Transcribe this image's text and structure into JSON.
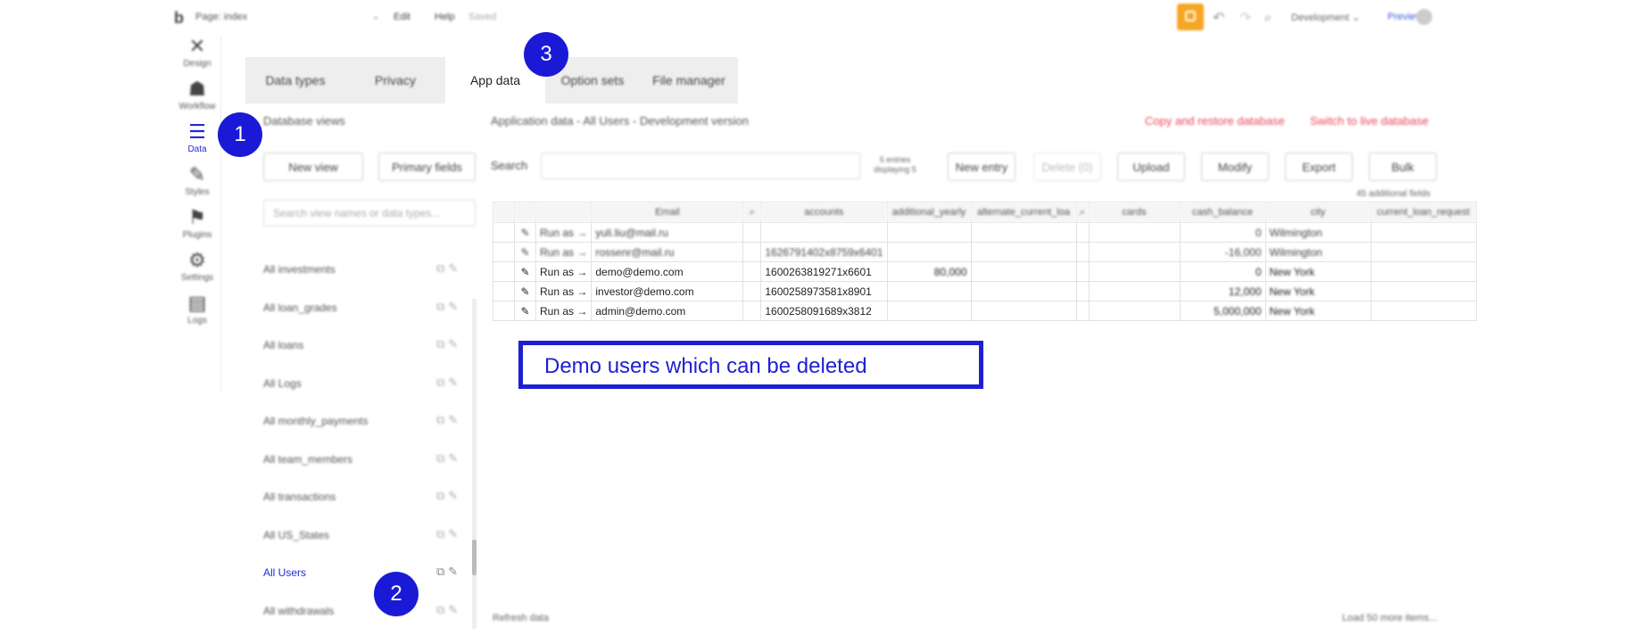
{
  "topbar": {
    "logo": "b",
    "page_title": "Page: index",
    "page_chevron": "⌄",
    "menu_edit": "Edit",
    "menu_help": "Help",
    "saved": "Saved",
    "undo_glyph": "↶",
    "redo_glyph": "↷",
    "search_glyph": "⌕",
    "environment": "Development ⌄",
    "preview": "Preview"
  },
  "rail": [
    {
      "label": "Design",
      "glyph": "✕",
      "active": false
    },
    {
      "label": "Workflow",
      "glyph": "☗",
      "active": false
    },
    {
      "label": "Data",
      "glyph": "☰",
      "active": true
    },
    {
      "label": "Styles",
      "glyph": "✎",
      "active": false
    },
    {
      "label": "Plugins",
      "glyph": "⚑",
      "active": false
    },
    {
      "label": "Settings",
      "glyph": "⚙",
      "active": false
    },
    {
      "label": "Logs",
      "glyph": "▤",
      "active": false
    }
  ],
  "tabs": [
    {
      "label": "Data types",
      "active": false
    },
    {
      "label": "Privacy",
      "active": false
    },
    {
      "label": "App data",
      "active": true
    },
    {
      "label": "Option sets",
      "active": false
    },
    {
      "label": "File manager",
      "active": false
    }
  ],
  "db_panel": {
    "title": "Database views",
    "new_view": "New view",
    "primary_fields": "Primary fields",
    "search_placeholder": "Search view names or data types...",
    "views": [
      {
        "label": "All investments",
        "active": false
      },
      {
        "label": "All loan_grades",
        "active": false
      },
      {
        "label": "All loans",
        "active": false
      },
      {
        "label": "All Logs",
        "active": false
      },
      {
        "label": "All monthly_payments",
        "active": false
      },
      {
        "label": "All team_members",
        "active": false
      },
      {
        "label": "All transactions",
        "active": false
      },
      {
        "label": "All US_States",
        "active": false
      },
      {
        "label": "All Users",
        "active": true
      },
      {
        "label": "All withdrawals",
        "active": false
      }
    ]
  },
  "app_data": {
    "title": "Application data - All Users - Development version",
    "copy_restore": "Copy and restore database",
    "switch_live": "Switch to live database",
    "search_label": "Search",
    "entries_info": "5 entries displaying 5",
    "new_entry": "New entry",
    "delete": "Delete (0)",
    "upload": "Upload",
    "modify": "Modify",
    "export": "Export",
    "bulk": "Bulk",
    "additional_fields": "45 additional fields",
    "refresh": "Refresh data",
    "load_more": "Load 50 more items..."
  },
  "table": {
    "columns": [
      "",
      "",
      "",
      "Email",
      "⌕",
      "accounts",
      "additional_yearly",
      "alternate_current_loa",
      "⌕",
      "cards",
      "cash_balance",
      "city",
      "current_loan_request"
    ],
    "rows": [
      {
        "blur": true,
        "run_as": "Run as →",
        "email": "yuli.liu@mail.ru",
        "accounts": "",
        "additional": "",
        "cash": "0",
        "city": "Wilmington"
      },
      {
        "blur": true,
        "run_as": "Run as →",
        "email": "rossenr@mail.ru",
        "accounts": "1626791402x8759x6401",
        "additional": "",
        "cash": "-16,000",
        "city": "Wilmington"
      },
      {
        "blur": false,
        "run_as": "Run as →",
        "email": "demo@demo.com",
        "accounts": "1600263819271x6601",
        "additional": "80,000",
        "cash": "0",
        "city": "New York"
      },
      {
        "blur": false,
        "run_as": "Run as →",
        "email": "investor@demo.com",
        "accounts": "1600258973581x8901",
        "additional": "",
        "cash": "12,000",
        "city": "New York"
      },
      {
        "blur": false,
        "run_as": "Run as →",
        "email": "admin@demo.com",
        "accounts": "1600258091689x3812",
        "additional": "",
        "cash": "5,000,000",
        "city": "New York"
      }
    ]
  },
  "callout": {
    "text": "Demo users which can be deleted"
  },
  "badges": {
    "one": "1",
    "two": "2",
    "three": "3"
  },
  "colors": {
    "accent": "#1f2bd6",
    "badge": "#1a1ad6",
    "link_red": "#e8455a",
    "orange": "#f5a623"
  }
}
